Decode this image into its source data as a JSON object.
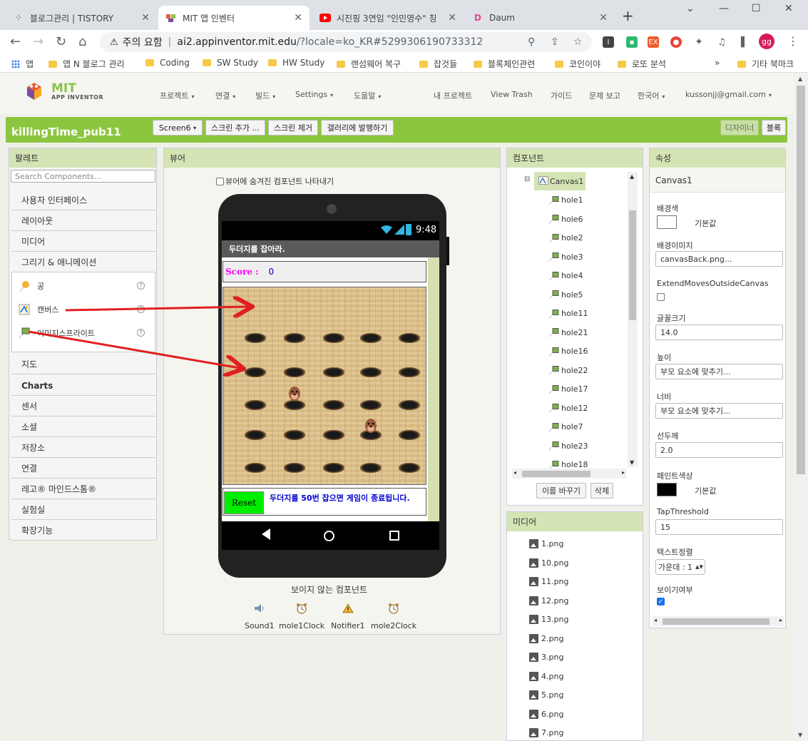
{
  "browser": {
    "tabs": [
      {
        "title": "블로그관리 | TISTORY",
        "icon": "tistory-icon"
      },
      {
        "title": "MIT 앱 인벤터",
        "icon": "mit-icon",
        "active": true
      },
      {
        "title": "시진핑 3연임 \"인민영수\" 칭",
        "icon": "youtube-icon"
      },
      {
        "title": "Daum",
        "icon": "daum-icon"
      }
    ],
    "security_label": "주의 요함",
    "url_host": "ai2.appinventor.mit.edu",
    "url_path": "/?locale=ko_KR#5299306190733312",
    "profile_initials": "gg",
    "bookmarks": [
      "앱",
      "앱 N 블로그 관리",
      "Coding",
      "SW Study",
      "HW Study",
      "랜섬웨어 복구",
      "잡것들",
      "블록체인관련",
      "코인이야",
      "로또 분석"
    ],
    "bookmarks_more": "»",
    "bookmarks_other": "기타 북마크"
  },
  "appinventor": {
    "logo_line1": "MIT",
    "logo_line2": "APP INVENTOR",
    "menu": [
      "프로젝트",
      "연결",
      "빌드",
      "Settings",
      "도움말"
    ],
    "right_menu": [
      "내 프로젝트",
      "View Trash",
      "가이드",
      "문제 보고",
      "한국어",
      "kussonjj@gmail.com"
    ],
    "project_title": "killingTime_pub11",
    "screen_select": "Screen6",
    "add_screen": "스크린 추가 ...",
    "remove_screen": "스크린 제거",
    "publish_gallery": "갤러리에 발행하기",
    "designer_btn": "디자이너",
    "blocks_btn": "블록"
  },
  "palette": {
    "title": "팔레트",
    "search_placeholder": "Search Components...",
    "categories_top": [
      "사용자 인터페이스",
      "레이아웃",
      "미디어",
      "그리기 & 애니메이션"
    ],
    "drawing_items": [
      {
        "label": "공",
        "icon": "ball-icon"
      },
      {
        "label": "캔버스",
        "icon": "canvas-icon"
      },
      {
        "label": "이미지스프라이트",
        "icon": "sprite-icon"
      }
    ],
    "categories_bottom": [
      "지도",
      "Charts",
      "센서",
      "소셜",
      "저장소",
      "연결",
      "레고® 마인드스톰®",
      "실험실",
      "확장기능"
    ]
  },
  "viewer": {
    "title": "뷰어",
    "show_hidden_label": "뷰어에 숨겨진 컴포넌트 나타내기",
    "status_time": "9:48",
    "app_title": "두더지를 잡아라.",
    "score_label": "Score :",
    "score_value": "0",
    "reset_label": "Reset",
    "end_message": "두더지를 50번 잡으면 게임이 종료됩니다.",
    "nonvisible_title": "보이지 않는 컴포넌트",
    "nonvisible": [
      {
        "label": "Sound1",
        "icon": "speaker-icon"
      },
      {
        "label": "mole1Clock",
        "icon": "clock-icon"
      },
      {
        "label": "Notifier1",
        "icon": "warning-icon"
      },
      {
        "label": "mole2Clock",
        "icon": "clock-icon"
      }
    ]
  },
  "components": {
    "title": "컴포넌트",
    "root": "Canvas1",
    "children": [
      "hole1",
      "hole6",
      "hole2",
      "hole3",
      "hole4",
      "hole5",
      "hole11",
      "hole21",
      "hole16",
      "hole22",
      "hole17",
      "hole12",
      "hole7",
      "hole23",
      "hole18"
    ],
    "rename_btn": "이름 바꾸기",
    "delete_btn": "삭제"
  },
  "media": {
    "title": "미디어",
    "files": [
      "1.png",
      "10.png",
      "11.png",
      "12.png",
      "13.png",
      "2.png",
      "3.png",
      "4.png",
      "5.png",
      "6.png",
      "7.png"
    ]
  },
  "properties": {
    "title": "속성",
    "component": "Canvas1",
    "bg_color_label": "배경색",
    "bg_color_value": "기본값",
    "bg_image_label": "배경이미지",
    "bg_image_value": "canvasBack.png...",
    "extend_label": "ExtendMovesOutsideCanvas",
    "font_size_label": "글꼴크기",
    "font_size_value": "14.0",
    "height_label": "높이",
    "height_value": "부모 요소에 맞추기...",
    "width_label": "너비",
    "width_value": "부모 요소에 맞추기...",
    "line_width_label": "선두께",
    "line_width_value": "2.0",
    "paint_color_label": "페인트색상",
    "paint_color_value": "기본값",
    "tap_label": "TapThreshold",
    "tap_value": "15",
    "text_align_label": "텍스트정렬",
    "text_align_value": "가운데 : 1",
    "visible_label": "보이기여부"
  },
  "colors": {
    "accent_green": "#8cc63f",
    "panel_head": "#d4e4b4",
    "score_label": "#ff00ff",
    "end_message": "#0000cc",
    "reset_bg": "#00ee00",
    "arrow": "#e02020"
  }
}
